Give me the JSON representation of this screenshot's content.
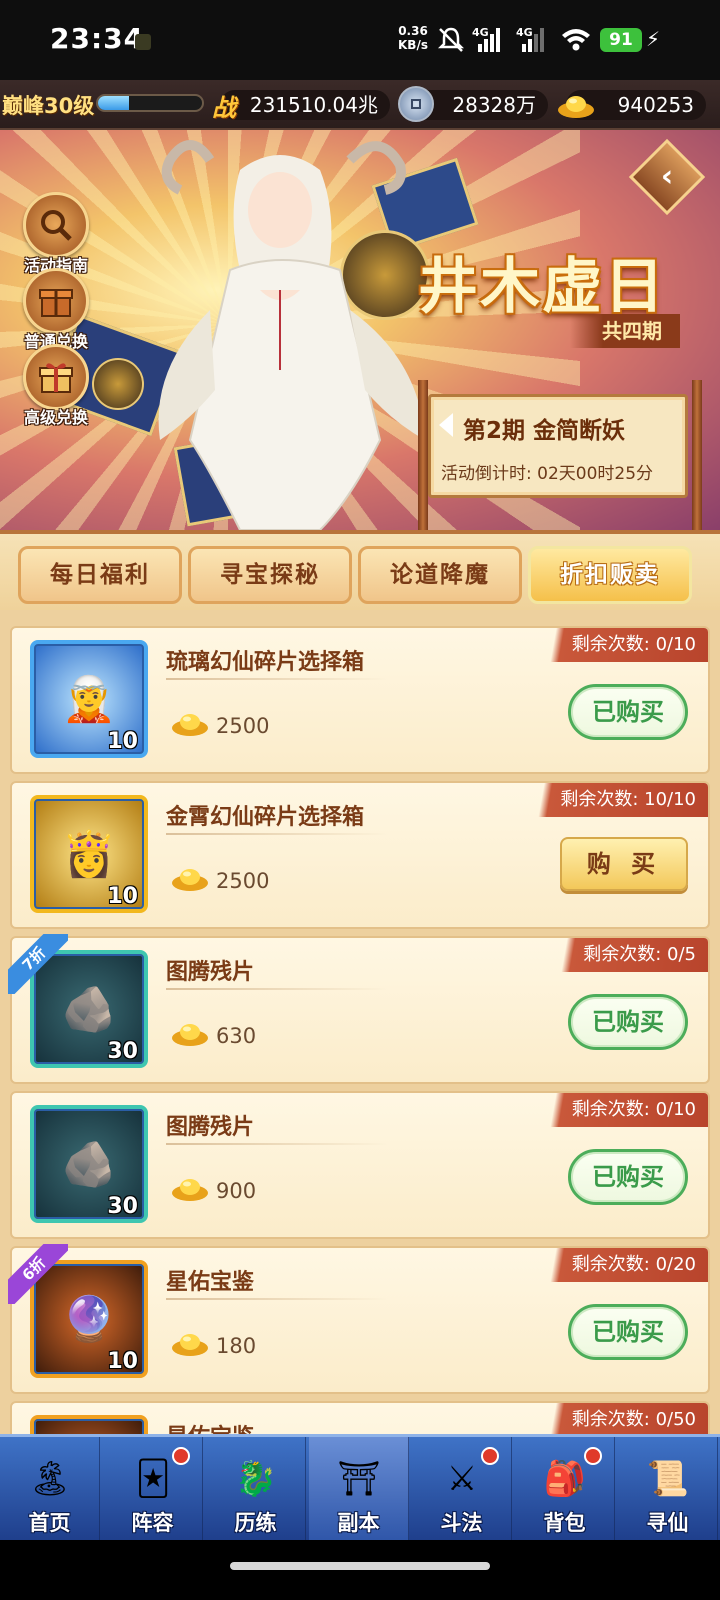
{
  "status_bar": {
    "time": "23:34",
    "net_speed": "0.36",
    "net_unit": "KB/s",
    "sig1": "4G",
    "sig2": "4G",
    "battery": "91"
  },
  "resources": {
    "level": "巅峰30级",
    "xp_fraction": 0.3,
    "power_icon_label": "战",
    "power": "231510.04兆",
    "coins": "28328万",
    "gold": "940253"
  },
  "banner": {
    "event_title": "井木虚日",
    "event_subtitle": "共四期",
    "period_label": "第2期  金简断妖",
    "countdown": "活动倒计时: 02天00时25分",
    "side_buttons": [
      {
        "label": "活动指南",
        "icon": "magnifier-icon"
      },
      {
        "label": "普通兑换",
        "icon": "gift-box-icon"
      },
      {
        "label": "高级兑换",
        "icon": "gift-icon"
      }
    ]
  },
  "tabs": [
    {
      "label": "每日福利",
      "active": false
    },
    {
      "label": "寻宝探秘",
      "active": false
    },
    {
      "label": "论道降魔",
      "active": false
    },
    {
      "label": "折扣贩卖",
      "active": true
    }
  ],
  "items": [
    {
      "name": "琉璃幻仙碎片选择箱",
      "price": "2500",
      "qty": "10",
      "remain": "剩余次数: 0/10",
      "button": "已购买",
      "bought": true,
      "discount": "",
      "frame_color": "#4aa8f0"
    },
    {
      "name": "金霄幻仙碎片选择箱",
      "price": "2500",
      "qty": "10",
      "remain": "剩余次数: 10/10",
      "button": "购 买",
      "bought": false,
      "discount": "",
      "frame_color": "#f2b81e"
    },
    {
      "name": "图腾残片",
      "price": "630",
      "qty": "30",
      "remain": "剩余次数: 0/5",
      "button": "已购买",
      "bought": true,
      "discount": "7折",
      "discount_color": "#3a8de0",
      "frame_color": "#3fc6b0"
    },
    {
      "name": "图腾残片",
      "price": "900",
      "qty": "30",
      "remain": "剩余次数: 0/10",
      "button": "已购买",
      "bought": true,
      "discount": "",
      "frame_color": "#3fc6b0"
    },
    {
      "name": "星佑宝鉴",
      "price": "180",
      "qty": "10",
      "remain": "剩余次数: 0/20",
      "button": "已购买",
      "bought": true,
      "discount": "6折",
      "discount_color": "#9a46d8",
      "frame_color": "#f0a020"
    },
    {
      "name": "星佑宝鉴",
      "price": "",
      "qty": "",
      "remain": "剩余次数: 0/50",
      "button": "",
      "bought": true,
      "discount": "",
      "frame_color": "#f0a020"
    }
  ],
  "bottom_nav": [
    {
      "label": "首页",
      "icon": "home-island-icon",
      "badge": false
    },
    {
      "label": "阵容",
      "icon": "cards-icon",
      "badge": true
    },
    {
      "label": "历练",
      "icon": "dragon-icon",
      "badge": false
    },
    {
      "label": "副本",
      "icon": "gate-icon",
      "badge": false,
      "active": true
    },
    {
      "label": "斗法",
      "icon": "sword-icon",
      "badge": true
    },
    {
      "label": "背包",
      "icon": "bag-icon",
      "badge": true
    },
    {
      "label": "寻仙",
      "icon": "scroll-icon",
      "badge": false
    }
  ]
}
